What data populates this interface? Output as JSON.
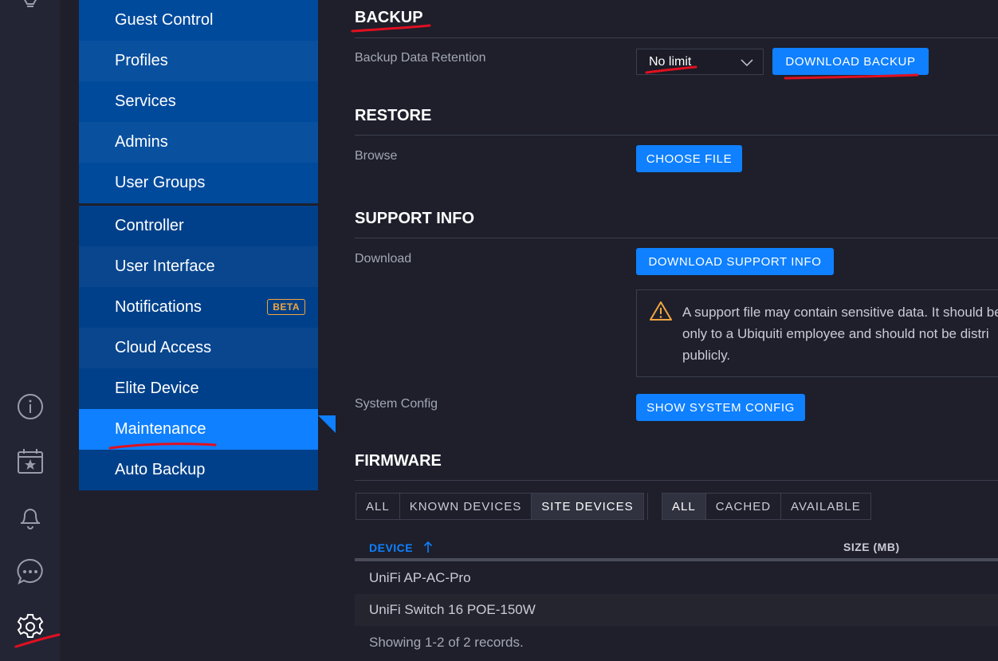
{
  "rail": {
    "icons": [
      "lightbulb-icon",
      "info-icon",
      "calendar-star-icon",
      "bell-icon",
      "chat-icon",
      "gear-icon"
    ]
  },
  "nav": {
    "group1": [
      "Guest Control",
      "Profiles",
      "Services",
      "Admins",
      "User Groups"
    ],
    "group2": [
      "Controller",
      "User Interface",
      "Notifications",
      "Cloud Access",
      "Elite Device",
      "Maintenance",
      "Auto Backup"
    ],
    "notifications_badge": "BETA",
    "active": "Maintenance"
  },
  "backup": {
    "title": "BACKUP",
    "retention_label": "Backup Data Retention",
    "retention_value": "No limit",
    "download_button": "DOWNLOAD BACKUP"
  },
  "restore": {
    "title": "RESTORE",
    "browse_label": "Browse",
    "choose_button": "CHOOSE FILE"
  },
  "support": {
    "title": "SUPPORT INFO",
    "download_label": "Download",
    "download_button": "DOWNLOAD SUPPORT INFO",
    "warning": "A support file may contain sensitive data. It should be\nonly to a Ubiquiti employee and should not be distri\npublicly.",
    "system_config_label": "System Config",
    "system_config_button": "SHOW SYSTEM CONFIG"
  },
  "firmware": {
    "title": "FIRMWARE",
    "filter1": [
      "ALL",
      "KNOWN DEVICES",
      "SITE DEVICES"
    ],
    "filter1_selected": "SITE DEVICES",
    "filter2": [
      "ALL",
      "CACHED",
      "AVAILABLE"
    ],
    "filter2_selected": "ALL",
    "col_device": "DEVICE",
    "sort_icon": "arrow-up-icon",
    "col_size": "SIZE (MB)",
    "rows": [
      "UniFi AP-AC-Pro",
      "UniFi Switch 16 POE-150W"
    ],
    "footer": "Showing 1-2 of 2 records."
  },
  "colors": {
    "accent": "#0f80ff",
    "nav_bg": "#004a9c",
    "page_bg": "#1e1f2b",
    "warning": "#f0a640",
    "annotation": "#e01020"
  }
}
